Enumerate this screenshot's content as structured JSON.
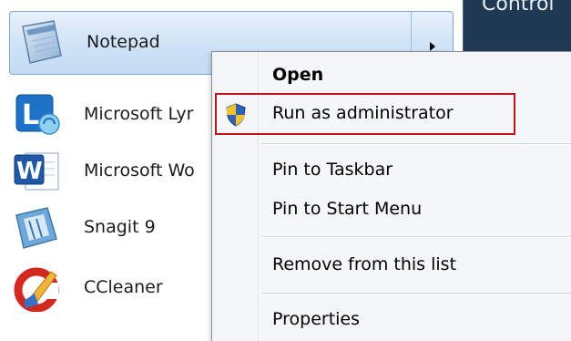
{
  "start_menu": {
    "items": [
      {
        "label": "Notepad",
        "icon": "notepad-icon"
      },
      {
        "label": "Microsoft Lyr",
        "icon": "lync-icon"
      },
      {
        "label": "Microsoft Wo",
        "icon": "word-icon"
      },
      {
        "label": "Snagit 9",
        "icon": "snagit-icon"
      },
      {
        "label": "CCleaner",
        "icon": "ccleaner-icon"
      }
    ]
  },
  "right_pane": {
    "label": "Control"
  },
  "context_menu": {
    "items": [
      {
        "label": "Open",
        "bold": true
      },
      {
        "label": "Run as administrator",
        "icon": "uac-shield-icon"
      },
      {
        "label": "Pin to Taskbar"
      },
      {
        "label": "Pin to Start Menu"
      },
      {
        "label": "Remove from this list"
      },
      {
        "label": "Properties"
      }
    ]
  },
  "colors": {
    "highlight_border": "#c0121c",
    "selected_item_bg": "#cfe2f7",
    "right_pane_bg": "#1f3a52"
  }
}
